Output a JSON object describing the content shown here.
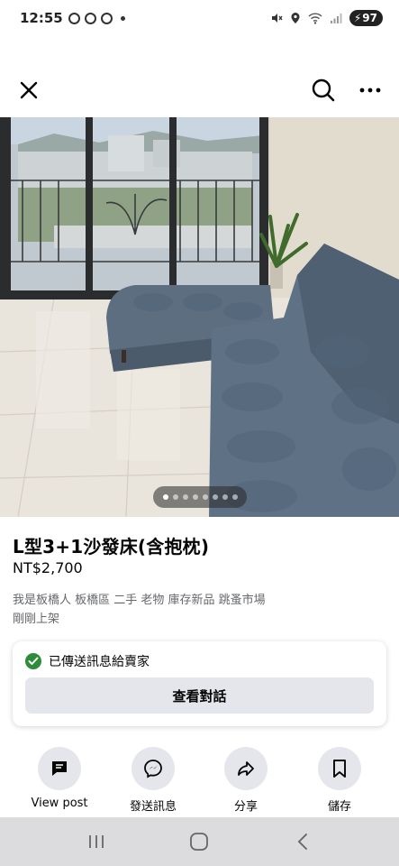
{
  "status_bar": {
    "time": "12:55",
    "battery": "97"
  },
  "icons": {
    "close": "close-icon",
    "search": "search-icon",
    "more": "more-icon"
  },
  "listing": {
    "title": "L型3+1沙發床(含抱枕)",
    "price": "NT$2,700",
    "seller_line": "我是板橋人 板橋區 二手 老物 庫存新品 跳蚤市場",
    "listed_time": "剛剛上架",
    "photo_count": 8,
    "active_photo": 1
  },
  "message_card": {
    "sent_text": "已傳送訊息給賣家",
    "view_button": "查看對話"
  },
  "actions": [
    {
      "label": "View post",
      "icon": "post-icon"
    },
    {
      "label": "發送訊息",
      "icon": "messenger-icon"
    },
    {
      "label": "分享",
      "icon": "share-icon"
    },
    {
      "label": "儲存",
      "icon": "bookmark-icon"
    }
  ],
  "colors": {
    "check_green": "#2e8b3a",
    "button_gray": "#e4e6eb",
    "secondary_text": "#65676b"
  }
}
